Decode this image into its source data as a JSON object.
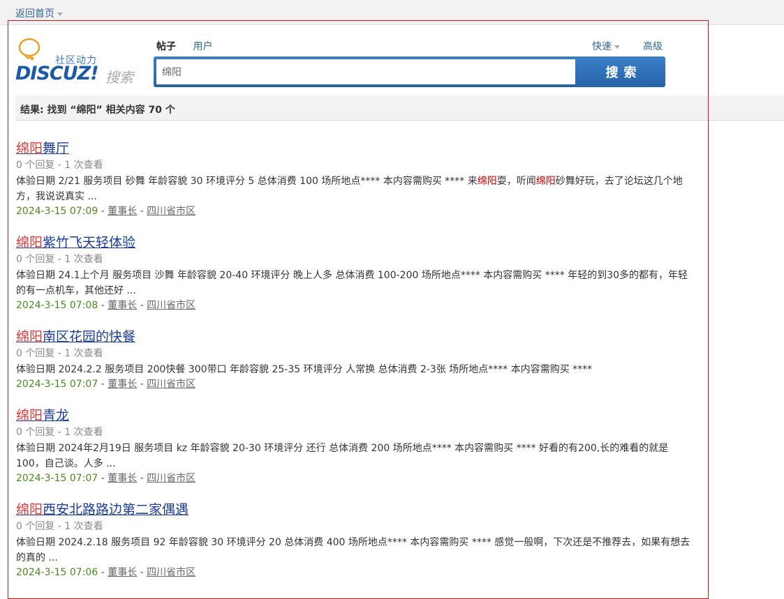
{
  "topbar": {
    "home_label": "返回首页"
  },
  "logo": {
    "cn_label": "社区动力",
    "main": "DISCUZ!",
    "sub": "搜索"
  },
  "search": {
    "tabs": [
      {
        "label": "帖子"
      },
      {
        "label": "用户"
      }
    ],
    "quick_label": "快速",
    "advanced_label": "高级",
    "value": "绵阳",
    "button_label": "搜索"
  },
  "result_summary": "结果: 找到 “绵阳” 相关内容 70 个",
  "results": [
    {
      "title_hl": "绵阳",
      "title_rest": "舞厅",
      "meta": "0 个回复 - 1 次查看",
      "summary_parts": [
        "体验日期 2/21 服务项目 砂舞 年龄容貌 30 环境评分 5 总体消费 100 场所地点**** 本内容需购买 **** 来",
        "绵阳",
        "耍，听闻",
        "绵阳",
        "砂舞好玩，去了论坛这几个地方，我说说真实 ..."
      ],
      "date": "2024-3-15 07:09",
      "author": "董事长",
      "forum": "四川省市区"
    },
    {
      "title_hl": "绵阳",
      "title_rest": "紫竹飞天轻体验",
      "meta": "0 个回复 - 1 次查看",
      "summary_parts": [
        "体验日期 24.1上个月 服务项目 沙舞 年龄容貌 20-40 环境评分 晚上人多 总体消费 100-200 场所地点**** 本内容需购买 **** 年轻的到30多的都有，年轻的有一点机车，其他还好 ..."
      ],
      "date": "2024-3-15 07:08",
      "author": "董事长",
      "forum": "四川省市区"
    },
    {
      "title_hl": "绵阳",
      "title_rest": "南区花园的快餐",
      "meta": "0 个回复 - 1 次查看",
      "summary_parts": [
        "体验日期 2024.2.2 服务项目 200快餐 300带口 年龄容貌 25-35 环境评分 人常换 总体消费 2-3张 场所地点**** 本内容需购买 ****"
      ],
      "date": "2024-3-15 07:07",
      "author": "董事长",
      "forum": "四川省市区"
    },
    {
      "title_hl": "绵阳",
      "title_rest": "青龙",
      "meta": "0 个回复 - 1 次查看",
      "summary_parts": [
        "体验日期 2024年2月19日 服务项目 kz 年龄容貌 20-30 环境评分 还行 总体消费 200 场所地点**** 本内容需购买 **** 好看的有200,长的难看的就是100，自己谈。人多 ..."
      ],
      "date": "2024-3-15 07:07",
      "author": "董事长",
      "forum": "四川省市区"
    },
    {
      "title_hl": "绵阳",
      "title_rest": "西安北路路边第二家偶遇",
      "meta": "0 个回复 - 1 次查看",
      "summary_parts": [
        "体验日期 2024.2.18 服务项目 92 年龄容貌 30 环境评分 20 总体消费 400 场所地点**** 本内容需购买 **** 感觉一般啊，下次还是不推荐去，如果有想去的真的 ..."
      ],
      "date": "2024-3-15 07:06",
      "author": "董事长",
      "forum": "四川省市区"
    }
  ]
}
